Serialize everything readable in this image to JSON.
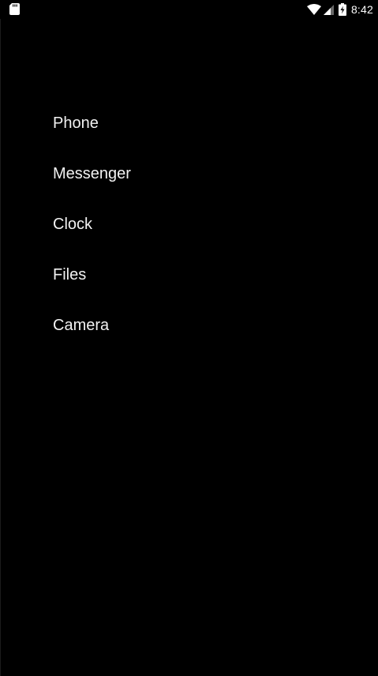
{
  "status_bar": {
    "time": "8:42",
    "icons": [
      "sd-card-icon",
      "wifi-icon",
      "signal-icon",
      "battery-charging-icon"
    ]
  },
  "app_list": {
    "items": [
      {
        "label": "Phone"
      },
      {
        "label": "Messenger"
      },
      {
        "label": "Clock"
      },
      {
        "label": "Files"
      },
      {
        "label": "Camera"
      }
    ]
  },
  "colors": {
    "background": "#000000",
    "text": "#f2f2f2"
  }
}
